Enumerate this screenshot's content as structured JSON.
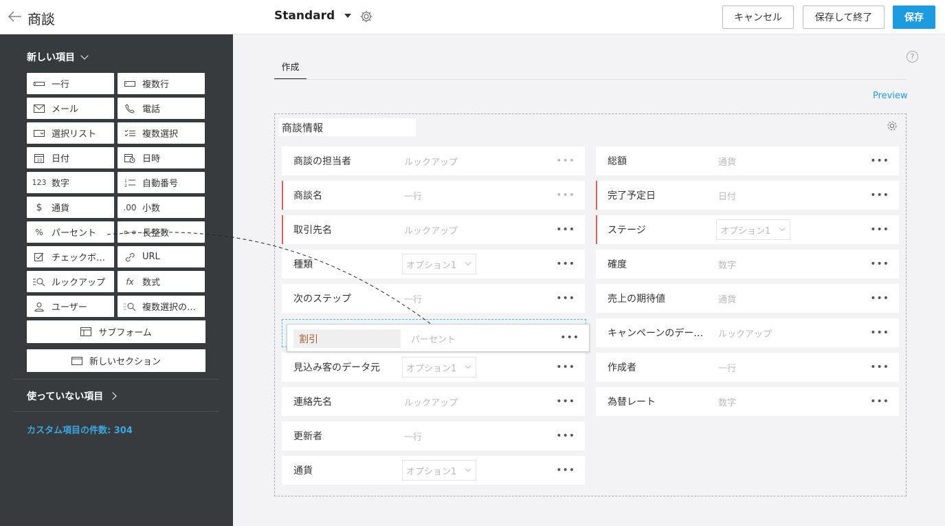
{
  "header": {
    "title": "商談",
    "layout_name": "Standard",
    "cancel_label": "キャンセル",
    "save_close_label": "保存して終了",
    "save_label": "保存"
  },
  "sidebar": {
    "new_fields_title": "新しい項目",
    "fields": [
      {
        "label": "一行",
        "icon": "single-line-icon"
      },
      {
        "label": "複数行",
        "icon": "multi-line-icon"
      },
      {
        "label": "メール",
        "icon": "mail-icon"
      },
      {
        "label": "電話",
        "icon": "phone-icon"
      },
      {
        "label": "選択リスト",
        "icon": "picklist-icon"
      },
      {
        "label": "複数選択",
        "icon": "multiselect-icon"
      },
      {
        "label": "日付",
        "icon": "date-icon"
      },
      {
        "label": "日時",
        "icon": "datetime-icon"
      },
      {
        "label": "数字",
        "icon": "number-icon"
      },
      {
        "label": "自動番号",
        "icon": "autonumber-icon"
      },
      {
        "label": "通貨",
        "icon": "currency-icon"
      },
      {
        "label": "小数",
        "icon": "decimal-icon"
      },
      {
        "label": "パーセント",
        "icon": "percent-icon"
      },
      {
        "label": "長整数",
        "icon": "long-integer-icon"
      },
      {
        "label": "チェックボ…",
        "icon": "checkbox-icon"
      },
      {
        "label": "URL",
        "icon": "url-icon"
      },
      {
        "label": "ルックアップ",
        "icon": "lookup-icon"
      },
      {
        "label": "数式",
        "icon": "formula-icon"
      },
      {
        "label": "ユーザー",
        "icon": "user-icon"
      },
      {
        "label": "複数選択の…",
        "icon": "multi-lookup-icon"
      }
    ],
    "subform_label": "サブフォーム",
    "new_section_label": "新しいセクション",
    "unused_fields_title": "使っていない項目",
    "custom_count": "カスタム項目の件数: 304"
  },
  "main": {
    "tab_label": "作成",
    "help_glyph": "?",
    "preview_label": "Preview",
    "section_title": "商談情報",
    "left_fields": [
      {
        "label": "商談の担当者",
        "placeholder": "ルックアップ",
        "type": "text",
        "required": false
      },
      {
        "label": "商談名",
        "placeholder": "一行",
        "type": "text",
        "required": true
      },
      {
        "label": "取引先名",
        "placeholder": "ルックアップ",
        "type": "text",
        "required": true
      },
      {
        "label": "種類",
        "placeholder": "オプション1",
        "type": "select",
        "required": false
      },
      {
        "label": "次のステップ",
        "placeholder": "一行",
        "type": "text",
        "required": false
      },
      {
        "label": "見込み客のデータ元",
        "placeholder": "オプション1",
        "type": "select",
        "required": false
      },
      {
        "label": "連絡先名",
        "placeholder": "ルックアップ",
        "type": "text",
        "required": false
      },
      {
        "label": "更新者",
        "placeholder": "一行",
        "type": "text",
        "required": false
      },
      {
        "label": "通貨",
        "placeholder": "オプション1",
        "type": "select",
        "required": false
      }
    ],
    "right_fields": [
      {
        "label": "総額",
        "placeholder": "通貨",
        "type": "text",
        "required": false
      },
      {
        "label": "完了予定日",
        "placeholder": "日付",
        "type": "text",
        "required": true
      },
      {
        "label": "ステージ",
        "placeholder": "オプション1",
        "type": "select",
        "required": true
      },
      {
        "label": "確度",
        "placeholder": "数字",
        "type": "text",
        "required": false
      },
      {
        "label": "売上の期待値",
        "placeholder": "通貨",
        "type": "text",
        "required": false
      },
      {
        "label": "キャンペーンのデー…",
        "placeholder": "ルックアップ",
        "type": "text",
        "required": false
      },
      {
        "label": "作成者",
        "placeholder": "一行",
        "type": "text",
        "required": false
      },
      {
        "label": "為替レート",
        "placeholder": "数字",
        "type": "text",
        "required": false
      }
    ],
    "dragging_field": {
      "label": "割引",
      "placeholder": "パーセント"
    }
  },
  "colors": {
    "accent": "#1d9be0",
    "sidebar_bg": "#383b3e",
    "required_marker": "#e05b5b",
    "count_text": "#3ba7e3"
  }
}
